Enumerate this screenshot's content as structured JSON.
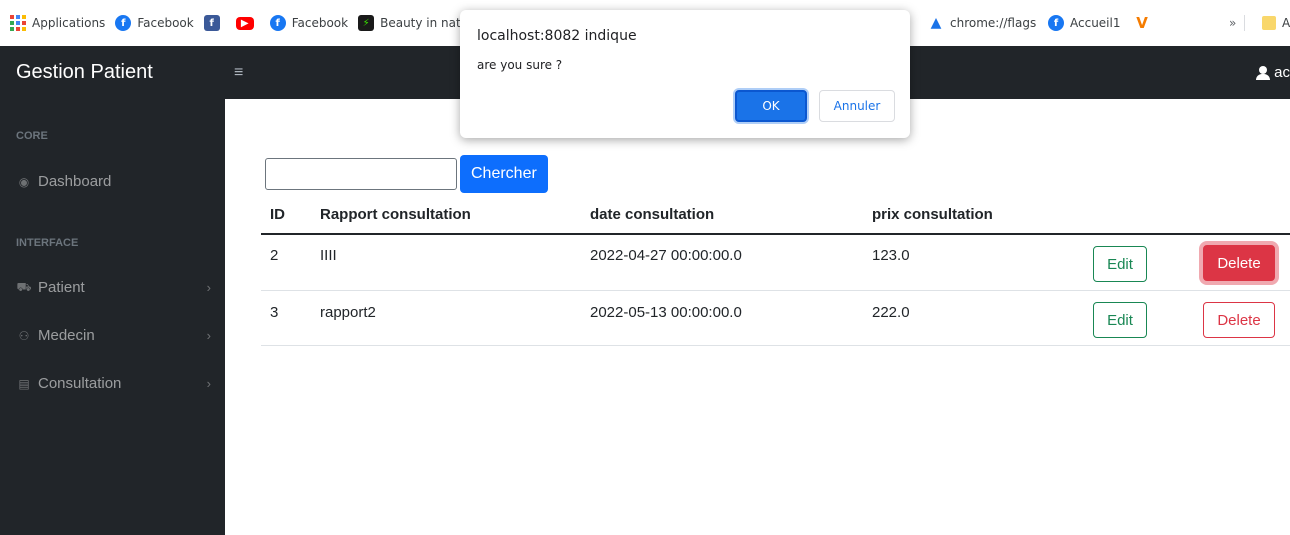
{
  "bookmarks": [
    {
      "label": "Applications",
      "icon": "apps-grid-icon"
    },
    {
      "label": "Facebook",
      "icon": "facebook-icon"
    },
    {
      "label": "",
      "icon": "facebook-square-icon"
    },
    {
      "label": "",
      "icon": "youtube-icon"
    },
    {
      "label": "Facebook",
      "icon": "facebook-icon"
    },
    {
      "label": "Beauty in nat",
      "icon": "beauty-icon"
    }
  ],
  "bookmarks_right": [
    {
      "label": "chrome://flags",
      "icon": "flask-icon"
    },
    {
      "label": "Accueil1",
      "icon": "facebook-icon"
    },
    {
      "label": "",
      "icon": "vivaldi-icon"
    }
  ],
  "bookmarks_overflow": "»",
  "bookmarks_folder_label": "A",
  "navbar": {
    "brand": "Gestion Patient",
    "hamburger": "≡",
    "user_label": "ac"
  },
  "sidebar": {
    "core_heading": "CORE",
    "interface_heading": "INTERFACE",
    "items": [
      {
        "label": "Dashboard",
        "icon": "dashboard-icon",
        "glyph": "◉"
      },
      {
        "label": "Patient",
        "icon": "car-icon",
        "glyph": "⛟",
        "chevron": "›"
      },
      {
        "label": "Medecin",
        "icon": "users-icon",
        "glyph": "⚇",
        "chevron": "›"
      },
      {
        "label": "Consultation",
        "icon": "list-icon",
        "glyph": "▤",
        "chevron": "›"
      }
    ]
  },
  "search": {
    "value": "",
    "button_label": "Chercher"
  },
  "table": {
    "headers": [
      "ID",
      "Rapport consultation",
      "date consultation",
      "prix consultation"
    ],
    "rows": [
      {
        "id": "2",
        "rapport": "IIII",
        "date": "2022-04-27 00:00:00.0",
        "prix": "123.0",
        "edit": "Edit",
        "delete": "Delete"
      },
      {
        "id": "3",
        "rapport": "rapport2",
        "date": "2022-05-13 00:00:00.0",
        "prix": "222.0",
        "edit": "Edit",
        "delete": "Delete"
      }
    ]
  },
  "dialog": {
    "title": "localhost:8082 indique",
    "message": "are you sure ?",
    "ok_label": "OK",
    "cancel_label": "Annuler"
  },
  "colors": {
    "sidebar_bg": "#212529",
    "primary": "#0d6efd",
    "success": "#198754",
    "danger": "#dc3545",
    "dialog_ok": "#1a73e8"
  }
}
